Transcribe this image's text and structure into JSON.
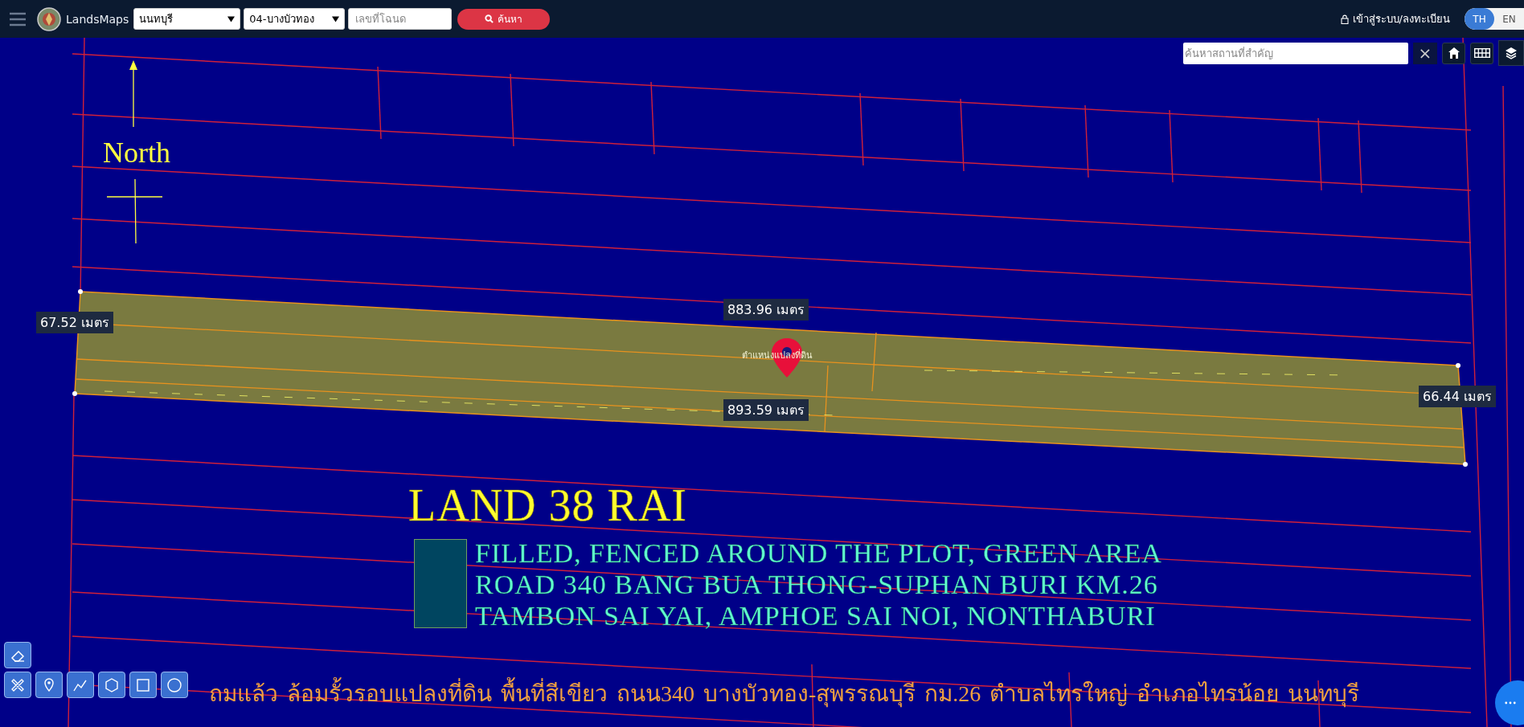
{
  "header": {
    "app_name": "LandsMaps",
    "province_select": "นนทบุรี",
    "district_select": "04-บางบัวทอง",
    "deed_field": {
      "placeholder": "เลขที่โฉนด"
    },
    "search_button": "ค้นหา",
    "login_link": "เข้าสู่ระบบ/ลงทะเบียน",
    "languages": [
      {
        "label": "TH",
        "selected": true
      },
      {
        "label": "EN",
        "selected": false
      }
    ]
  },
  "map": {
    "place_search": {
      "placeholder": "ค้นหาสถานที่สำคัญ"
    },
    "clear_button": "×",
    "north_label": "North",
    "measurements": [
      "67.52 เมตร",
      "883.96 เมตร",
      "893.59 เมตร",
      "66.44 เมตร"
    ],
    "pin_label": "ตำแหน่งแปลงที่ดิน",
    "title": "LAND 38 RAI",
    "description_lines": [
      "FILLED, FENCED AROUND THE PLOT, GREEN AREA",
      "ROAD 340 BANG BUA THONG-SUPHAN BURI KM.26",
      "TAMBON SAI YAI, AMPHOE SAI NOI, NONTHABURI"
    ],
    "thai_caption": "ถมแล้ว  ล้อมรั้วรอบแปลงที่ดิน  พื้นที่สีเขียว  ถนน340  บางบัวทอง-สุพรรณบุรี  กม.26  ตำบลไทรใหญ่  อำเภอไทรน้อย  นนทบุรี"
  }
}
